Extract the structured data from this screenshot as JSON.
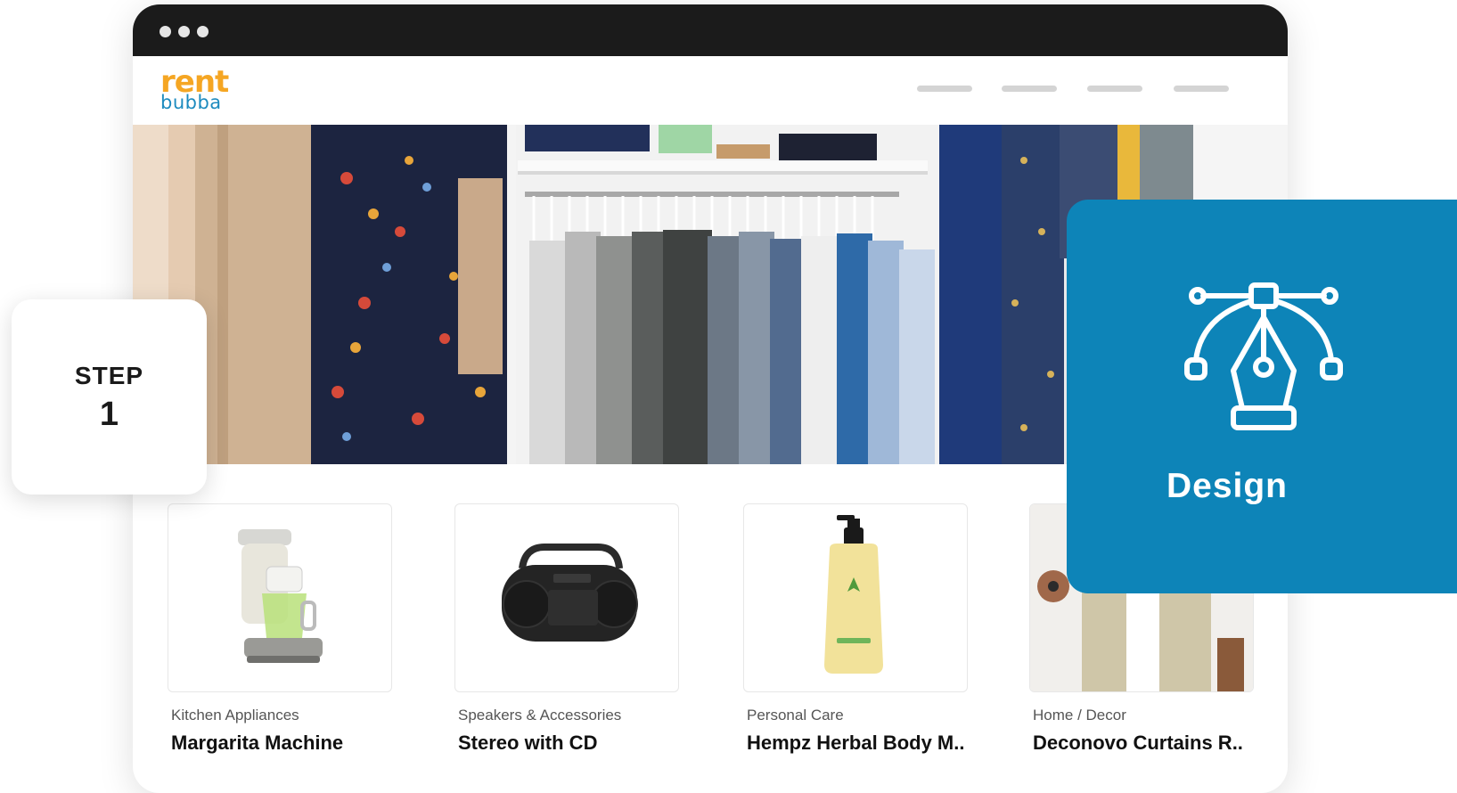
{
  "brand": {
    "logo_top": "rent",
    "logo_bottom": "bubba"
  },
  "step": {
    "label": "STEP",
    "number": "1"
  },
  "feature": {
    "label": "Design",
    "icon": "pen-tool-icon"
  },
  "products": [
    {
      "category": "Kitchen Appliances",
      "title": "Margarita Machine"
    },
    {
      "category": "Speakers & Accessories",
      "title": "Stereo with CD"
    },
    {
      "category": "Personal Care",
      "title": "Hempz Herbal Body M.."
    },
    {
      "category": "Home / Decor",
      "title": "Deconovo Curtains R.."
    }
  ],
  "colors": {
    "accent": "#0d84b8",
    "logo_orange": "#f5a623",
    "logo_blue": "#1d8bbf",
    "titlebar": "#1b1b1b"
  }
}
